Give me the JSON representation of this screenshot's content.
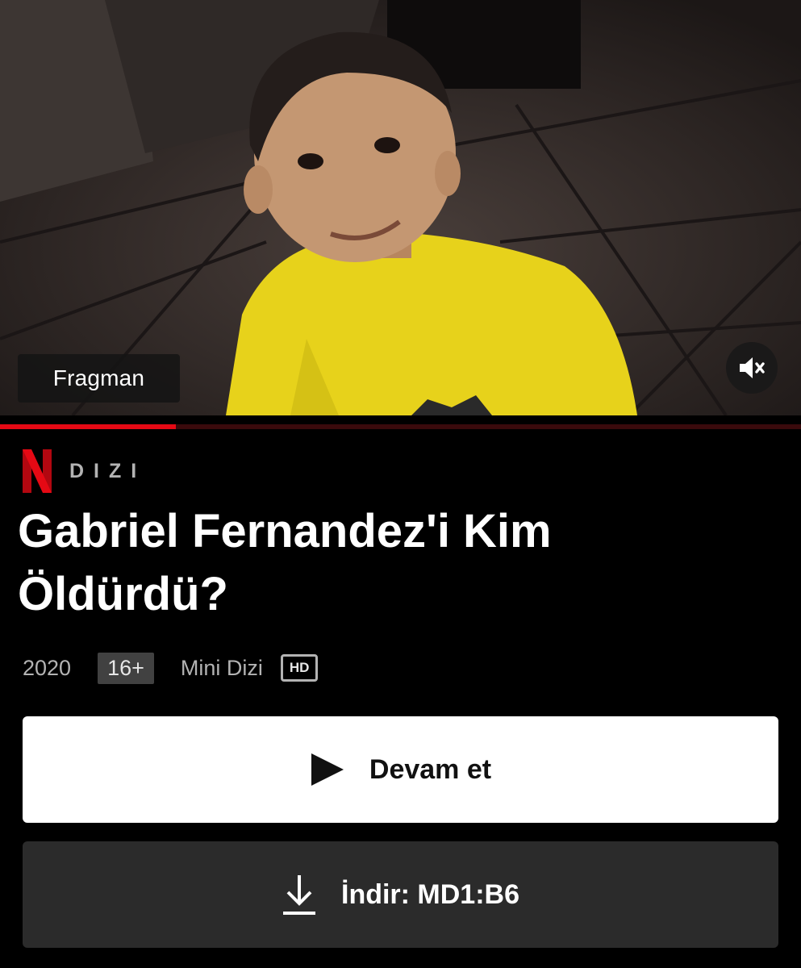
{
  "hero": {
    "trailer_label": "Fragman",
    "mute_icon": "speaker-muted-icon",
    "progress_fraction": 0.22
  },
  "brand": {
    "logo_icon": "netflix-n-logo",
    "type_label": "DIZI"
  },
  "title": "Gabriel Fernandez'i Kim Öldürdü?",
  "meta": {
    "year": "2020",
    "rating": "16+",
    "type": "Mini Dizi",
    "quality": "HD"
  },
  "actions": {
    "play": {
      "label": "Devam et",
      "icon": "play-icon"
    },
    "download": {
      "label": "İndir: MD1:B6",
      "icon": "download-icon"
    }
  },
  "colors": {
    "accent": "#e50914",
    "background": "#000000",
    "play_button_bg": "#ffffff",
    "download_button_bg": "#2b2b2b"
  }
}
